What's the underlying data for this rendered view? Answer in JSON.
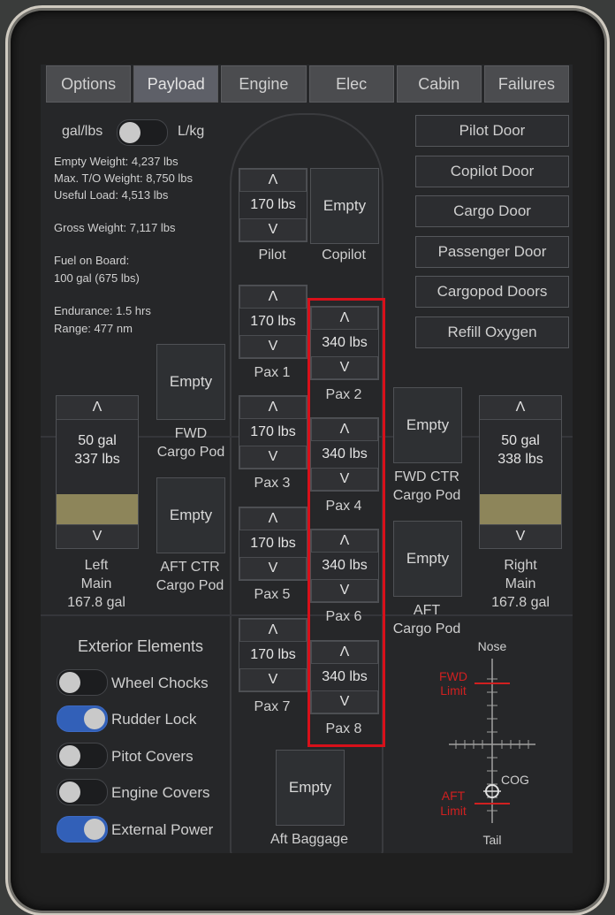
{
  "tabs": [
    "Options",
    "Payload",
    "Engine",
    "Elec",
    "Cabin",
    "Failures"
  ],
  "units": {
    "left": "gal/lbs",
    "right": "L/kg"
  },
  "info": {
    "empty_weight": "Empty Weight: 4,237 lbs",
    "max_to_weight": "Max. T/O Weight: 8,750 lbs",
    "useful_load": "Useful Load: 4,513 lbs",
    "gross_weight": "Gross Weight: 7,117 lbs",
    "fuel_label": "Fuel on Board:",
    "fuel_value": "100 gal (675 lbs)",
    "endurance": "Endurance: 1.5 hrs",
    "range": "Range: 477 nm"
  },
  "doors": [
    "Pilot Door",
    "Copilot Door",
    "Cargo Door",
    "Passenger Door",
    "Cargopod Doors",
    "Refill Oxygen"
  ],
  "seats": {
    "pilot": {
      "value": "170 lbs",
      "label": "Pilot"
    },
    "copilot": {
      "value": "Empty",
      "label": "Copilot"
    },
    "pax1": {
      "value": "170 lbs",
      "label": "Pax 1"
    },
    "pax2": {
      "value": "340 lbs",
      "label": "Pax 2"
    },
    "pax3": {
      "value": "170 lbs",
      "label": "Pax 3"
    },
    "pax4": {
      "value": "340 lbs",
      "label": "Pax 4"
    },
    "pax5": {
      "value": "170 lbs",
      "label": "Pax 5"
    },
    "pax6": {
      "value": "340 lbs",
      "label": "Pax 6"
    },
    "pax7": {
      "value": "170 lbs",
      "label": "Pax 7"
    },
    "pax8": {
      "value": "340 lbs",
      "label": "Pax 8"
    }
  },
  "arrows": {
    "up": "Λ",
    "down": "V"
  },
  "cargo": {
    "fwd_pod": {
      "value": "Empty",
      "label1": "FWD",
      "label2": "Cargo Pod"
    },
    "aft_ctr_pod": {
      "value": "Empty",
      "label1": "AFT CTR",
      "label2": "Cargo Pod"
    },
    "fwd_ctr_pod": {
      "value": "Empty",
      "label1": "FWD CTR",
      "label2": "Cargo Pod"
    },
    "aft_pod": {
      "value": "Empty",
      "label1": "AFT",
      "label2": "Cargo Pod"
    },
    "aft_baggage": {
      "value": "Empty",
      "label": "Aft Baggage"
    }
  },
  "tanks": {
    "left": {
      "gal": "50 gal",
      "lbs": "337 lbs",
      "label1": "Left",
      "label2": "Main",
      "label3": "167.8 gal",
      "level": 0.3
    },
    "right": {
      "gal": "50 gal",
      "lbs": "338 lbs",
      "label1": "Right",
      "label2": "Main",
      "label3": "167.8 gal",
      "level": 0.3
    }
  },
  "exterior": {
    "title": "Exterior Elements",
    "items": [
      {
        "label": "Wheel Chocks",
        "on": false
      },
      {
        "label": "Rudder Lock",
        "on": true
      },
      {
        "label": "Pitot Covers",
        "on": false
      },
      {
        "label": "Engine Covers",
        "on": false
      },
      {
        "label": "External Power",
        "on": true
      }
    ]
  },
  "cog": {
    "nose": "Nose",
    "tail": "Tail",
    "fwd1": "FWD",
    "fwd2": "Limit",
    "aft1": "AFT",
    "aft2": "Limit",
    "cog": "COG",
    "limit_color": "#d02020"
  }
}
